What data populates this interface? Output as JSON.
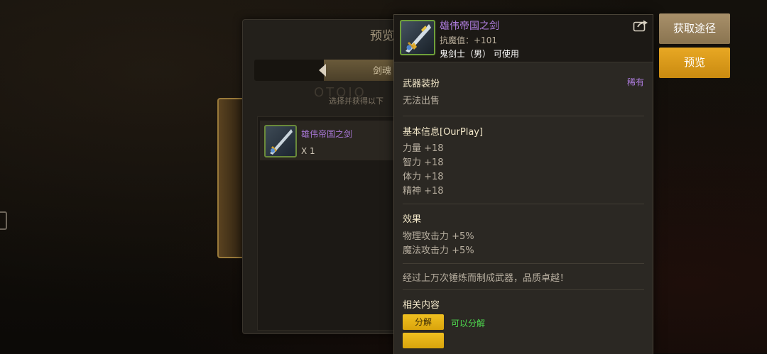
{
  "background_panel": {
    "title": "预览",
    "tab_label": "剑魂",
    "hint": "选择并获得以下",
    "watermark": "OTOIO",
    "item": {
      "name": "雄伟帝国之剑",
      "quantity": "X 1"
    }
  },
  "tooltip": {
    "item_name": "雄伟帝国之剑",
    "magic_resistance": "抗魔值：+101",
    "job_restriction": "鬼剑士（男） 可使用",
    "share_icon": "share-icon",
    "category": "武器装扮",
    "rarity": "稀有",
    "sell_status": "无法出售",
    "basic_info": {
      "title": "基本信息[OurPlay]",
      "stats": [
        "力量 +18",
        "智力 +18",
        "体力 +18",
        "精神 +18"
      ]
    },
    "effects": {
      "title": "效果",
      "lines": [
        "物理攻击力 +5%",
        "魔法攻击力 +5%"
      ]
    },
    "description": "经过上万次锤炼而制成武器，品质卓越！",
    "related": {
      "title": "相关内容",
      "decompose_button": "分解",
      "decompose_status": "可以分解"
    }
  },
  "actions": {
    "obtain_label": "获取途径",
    "preview_label": "预览"
  },
  "colors": {
    "rarity_purple": "#b07ee0",
    "gold_button": "#e8a824",
    "green_status": "#4fd94f"
  }
}
